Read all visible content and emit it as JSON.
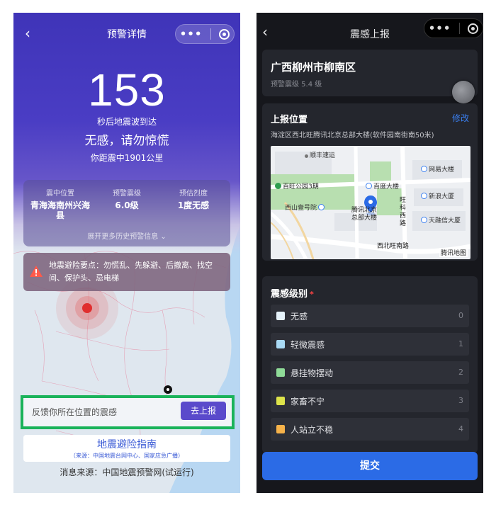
{
  "left": {
    "nav": {
      "title": "预警详情",
      "back_icon": "chevron-left-icon",
      "more_icon": "more-dots-icon",
      "target_icon": "target-icon"
    },
    "countdown": {
      "value": "153",
      "subtitle": "秒后地震波到达"
    },
    "status": "无感，请勿惊慌",
    "distance": "你距震中1901公里",
    "info": {
      "columns": [
        {
          "label": "震中位置",
          "value": "青海海南州兴海县"
        },
        {
          "label": "预警震级",
          "value": "6.0级"
        },
        {
          "label": "预估烈度",
          "value": "1度无感"
        }
      ],
      "more": "展开更多历史预警信息 ⌄"
    },
    "tips": "地震避险要点：勿慌乱、先躲避、后撤离、找空间、保护头、忌电梯",
    "feedback": {
      "prompt": "反馈你所在位置的震感",
      "button": "去上报"
    },
    "guide": {
      "title": "地震避险指南",
      "source": "（来源：中国地震台网中心、国家应急广播）"
    },
    "source_line": "消息来源：中国地震预警网(试运行)",
    "colors": {
      "hero": "#4a3dc4",
      "highlight_border": "#1ab35a",
      "report_button": "#5a4acb"
    }
  },
  "right": {
    "nav": {
      "title": "震感上报",
      "back_icon": "chevron-left-icon",
      "more_icon": "more-dots-icon",
      "target_icon": "target-icon"
    },
    "quake": {
      "location": "广西柳州市柳南区",
      "magnitude": "预警震级 5.4 级"
    },
    "report_location": {
      "title": "上报位置",
      "edit": "修改",
      "address": "海淀区西北旺腾讯北京总部大楼(软件园南街南50米)",
      "map_labels": {
        "shunfeng": "顺丰速运",
        "wangyi": "网易大楼",
        "baiwang": "百旺公园3期",
        "baidu": "百度大楼",
        "xinlang": "新浪大厦",
        "xishan": "西山壹号院",
        "tencent": "腾讯北京总部大楼",
        "wangxi_road": "旺科西路",
        "tianrong": "天融信大厦",
        "xibeiwang_road": "西北旺南路",
        "map_logo": "腾讯地图"
      }
    },
    "level": {
      "title": "震感级别",
      "required_mark": "*",
      "items": [
        {
          "label": "无感",
          "num": "0",
          "color": "#e6f3fb"
        },
        {
          "label": "轻微震感",
          "num": "1",
          "color": "#a9daf5"
        },
        {
          "label": "悬挂物摆动",
          "num": "2",
          "color": "#8fdb98"
        },
        {
          "label": "家畜不宁",
          "num": "3",
          "color": "#dde34a"
        },
        {
          "label": "人站立不稳",
          "num": "4",
          "color": "#f6b24a"
        }
      ]
    },
    "submit": "提交",
    "colors": {
      "background": "#16171c",
      "card": "#24262d",
      "accent": "#2b6be6",
      "link": "#3a7ff0"
    }
  }
}
